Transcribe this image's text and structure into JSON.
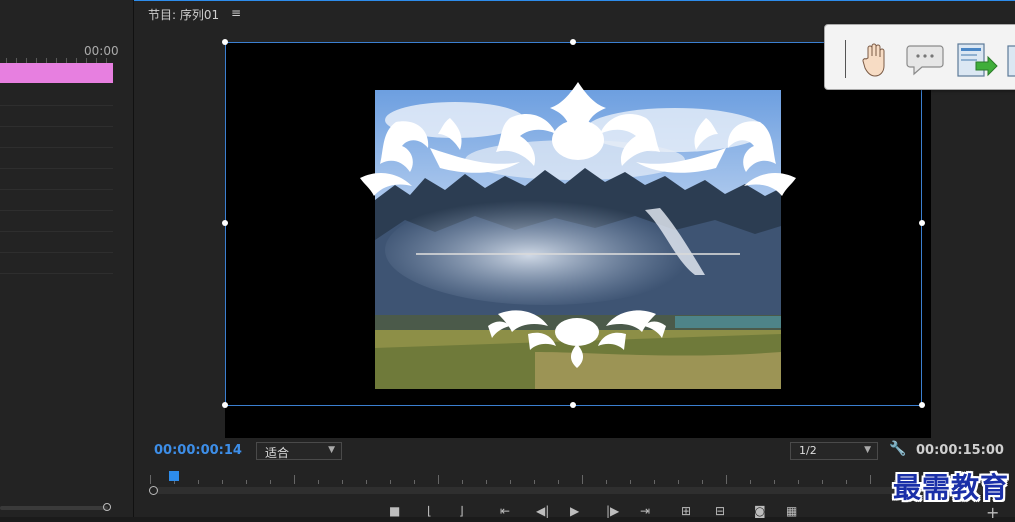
{
  "left_timeline": {
    "time_label": "00:00",
    "clip_color": "#e77fe0"
  },
  "program_monitor": {
    "title": "节目: 序列01",
    "current_timecode": "00:00:00:14",
    "fit_select": {
      "value": "适合"
    },
    "resolution_select": {
      "value": "1/2"
    },
    "duration": "00:00:15:00",
    "playhead_fraction": 0.03,
    "accent_color": "#2d8ceb"
  },
  "tool_popup": {
    "icons": [
      "hand-icon",
      "comment-icon",
      "export-icon",
      "page-icon"
    ]
  },
  "controls": {
    "icons": [
      "stop-icon",
      "mark-in-icon",
      "mark-out-icon",
      "go-to-in-icon",
      "step-back-icon",
      "play-icon",
      "step-forward-icon",
      "go-to-out-icon",
      "insert-icon",
      "overwrite-icon",
      "export-frame-icon",
      "compare-icon",
      "add-icon"
    ]
  },
  "watermark": {
    "text": "最需教育"
  }
}
